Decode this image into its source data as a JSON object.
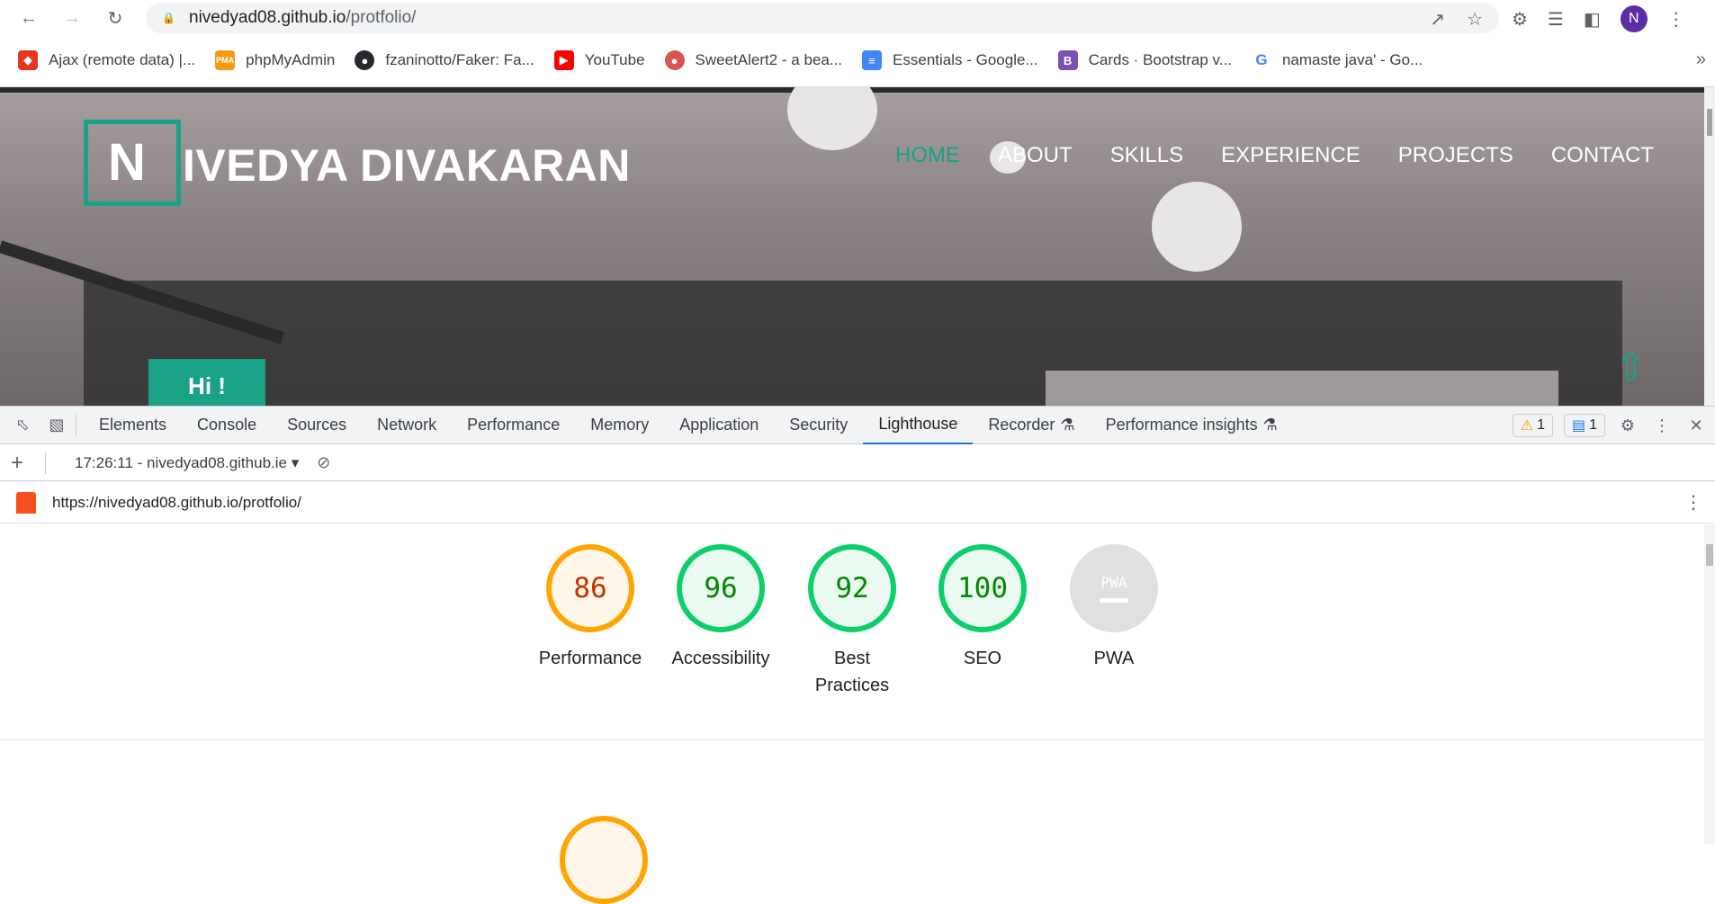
{
  "browser": {
    "url_host": "nivedyad08.github.io",
    "url_path": "/protfolio/",
    "profile_initial": "N"
  },
  "bookmarks": [
    {
      "label": "Ajax (remote data) |...",
      "icon": "ajax-icon",
      "color": "#e8371f"
    },
    {
      "label": "phpMyAdmin",
      "icon": "phpmyadmin-icon",
      "color": "#f39c12"
    },
    {
      "label": "fzaninotto/Faker: Fa...",
      "icon": "github-icon",
      "color": "#24292e"
    },
    {
      "label": "YouTube",
      "icon": "youtube-icon",
      "color": "#ff0000"
    },
    {
      "label": "SweetAlert2 - a bea...",
      "icon": "sweetalert-icon",
      "color": "#d9534f"
    },
    {
      "label": "Essentials - Google...",
      "icon": "google-docs-icon",
      "color": "#4285f4"
    },
    {
      "label": "Cards · Bootstrap v...",
      "icon": "bootstrap-icon",
      "color": "#7952b3"
    },
    {
      "label": "namaste java' - Go...",
      "icon": "google-icon",
      "color": "#4285f4"
    }
  ],
  "site": {
    "logo_letter": "N",
    "logo_rest": "IVEDYA DIVAKARAN",
    "nav": [
      "HOME",
      "ABOUT",
      "SKILLS",
      "EXPERIENCE",
      "PROJECTS",
      "CONTACT"
    ],
    "active_nav": "HOME",
    "hi_text": "Hi !",
    "accent": "#1aa287"
  },
  "devtools": {
    "tabs": [
      "Elements",
      "Console",
      "Sources",
      "Network",
      "Performance",
      "Memory",
      "Application",
      "Security",
      "Lighthouse",
      "Recorder",
      "Performance insights"
    ],
    "active_tab": "Lighthouse",
    "warnings_count": "1",
    "messages_count": "1",
    "report_selector": "17:26:11 - nivedyad08.github.iе",
    "report_url": "https://nivedyad08.github.io/protfolio/"
  },
  "scores": [
    {
      "value": "86",
      "label": "Performance",
      "status": "average"
    },
    {
      "value": "96",
      "label": "Accessibility",
      "status": "pass"
    },
    {
      "value": "92",
      "label": "Best Practices",
      "status": "pass"
    },
    {
      "value": "100",
      "label": "SEO",
      "status": "pass"
    },
    {
      "value": "PWA",
      "label": "PWA",
      "status": "na"
    }
  ],
  "colors": {
    "score_average": "#ffa400",
    "score_pass": "#0cce6b",
    "devtools_active": "#1a73e8"
  }
}
